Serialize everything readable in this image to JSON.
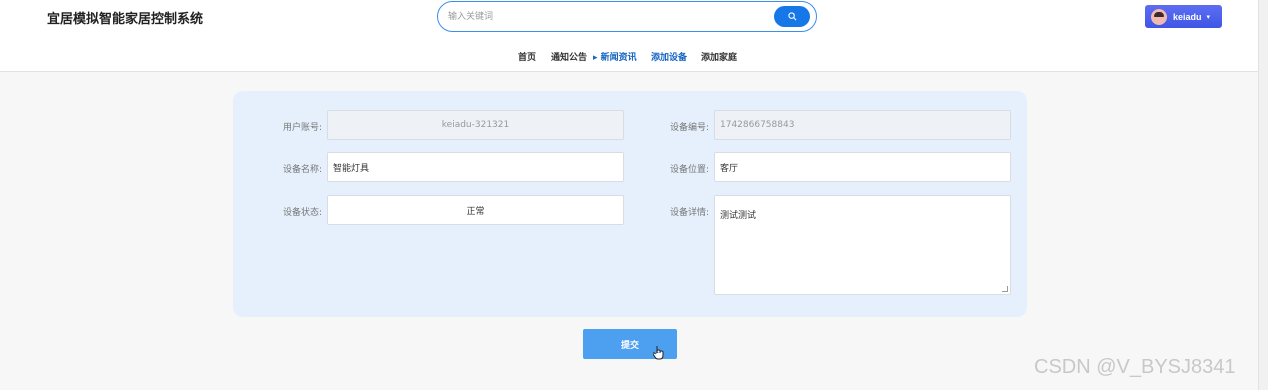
{
  "header": {
    "title": "宜居模拟智能家居控制系统",
    "search_placeholder": "输入关键词",
    "user_name": "keiadu",
    "caret": "▾"
  },
  "nav": [
    {
      "label": "首页"
    },
    {
      "label": "通知公告"
    },
    {
      "label": "▸ 新闻资讯"
    },
    {
      "label": "添加设备"
    },
    {
      "label": "添加家庭"
    }
  ],
  "form": {
    "user_account_label": "用户账号:",
    "user_account_value": "keiadu-321321",
    "device_number_label": "设备编号:",
    "device_number_value": "1742866758843",
    "device_name_label": "设备名称:",
    "device_name_value": "智能灯具",
    "device_location_label": "设备位置:",
    "device_location_value": "客厅",
    "device_status_label": "设备状态:",
    "device_status_value": "正常",
    "device_detail_label": "设备详情:",
    "device_detail_value": "测试测试",
    "submit_label": "提交"
  },
  "watermark": "CSDN @V_BYSJ8341",
  "colors": {
    "accent": "#1677e8",
    "user_button": "#4a5ff0",
    "nav_active": "#1565c0",
    "form_bg": "#e6f0fc",
    "submit": "#4d9ff0"
  }
}
